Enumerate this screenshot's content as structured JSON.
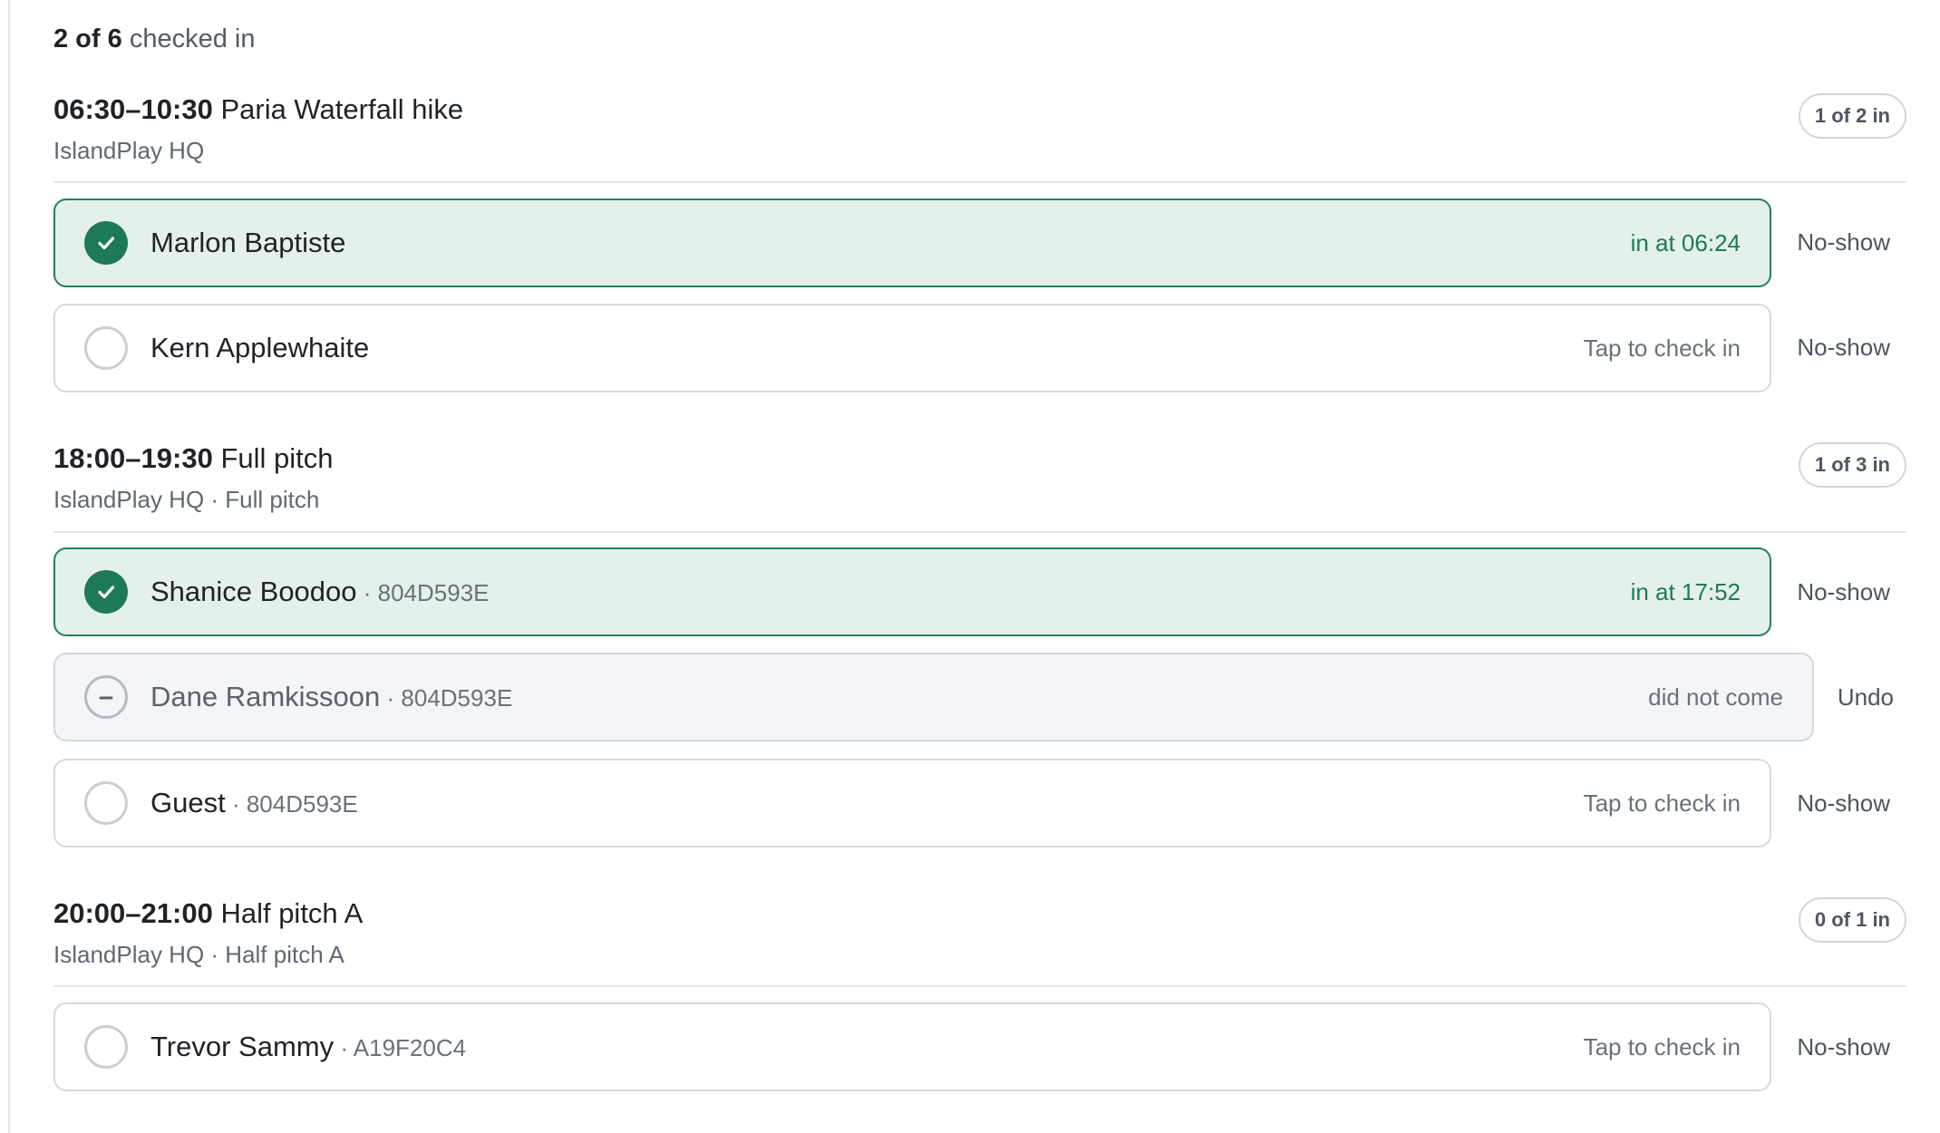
{
  "summary": {
    "count": "2 of 6",
    "suffix": "checked in"
  },
  "sessions": [
    {
      "time": "06:30–10:30",
      "title": "Paria Waterfall hike",
      "location": "IslandPlay HQ",
      "badge": "1 of 2 in",
      "attendees": [
        {
          "name": "Marlon Baptiste",
          "code": "",
          "status": "in at 06:24",
          "action": "No-show"
        },
        {
          "name": "Kern Applewhaite",
          "code": "",
          "status": "Tap to check in",
          "action": "No-show"
        }
      ]
    },
    {
      "time": "18:00–19:30",
      "title": "Full pitch",
      "location": "IslandPlay HQ · Full pitch",
      "badge": "1 of 3 in",
      "attendees": [
        {
          "name": "Shanice Boodoo",
          "code": " · 804D593E",
          "status": "in at 17:52",
          "action": "No-show"
        },
        {
          "name": "Dane Ramkissoon",
          "code": " · 804D593E",
          "status": "did not come",
          "action": "Undo"
        },
        {
          "name": "Guest",
          "code": " · 804D593E",
          "status": "Tap to check in",
          "action": "No-show"
        }
      ]
    },
    {
      "time": "20:00–21:00",
      "title": "Half pitch A",
      "location": "IslandPlay HQ · Half pitch A",
      "badge": "0 of 1 in",
      "attendees": [
        {
          "name": "Trevor Sammy",
          "code": " · A19F20C4",
          "status": "Tap to check in",
          "action": "No-show"
        }
      ]
    }
  ],
  "colors": {
    "checked": "#1e7a56",
    "checked_bg": "#e3f1ea",
    "noshow_bg": "#f3f5f8"
  },
  "icons": {
    "checked": "check-circle-icon",
    "pending": "empty-circle-icon",
    "noshow": "minus-circle-icon"
  }
}
